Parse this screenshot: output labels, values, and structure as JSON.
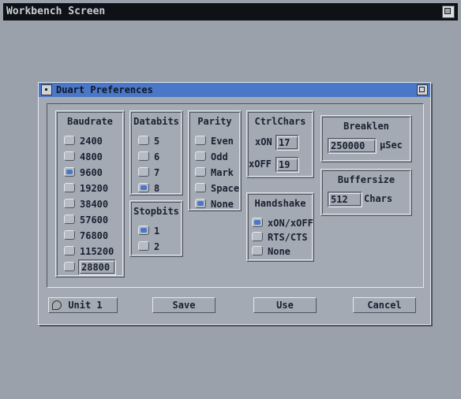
{
  "screen": {
    "title": "Workbench Screen"
  },
  "window": {
    "title": "Duart Preferences"
  },
  "baudrate": {
    "title": "Baudrate",
    "options": [
      {
        "label": "2400",
        "selected": false
      },
      {
        "label": "4800",
        "selected": false
      },
      {
        "label": "9600",
        "selected": true
      },
      {
        "label": "19200",
        "selected": false
      },
      {
        "label": "38400",
        "selected": false
      },
      {
        "label": "57600",
        "selected": false
      },
      {
        "label": "76800",
        "selected": false
      },
      {
        "label": "115200",
        "selected": false
      }
    ],
    "custom_value": "28800"
  },
  "databits": {
    "title": "Databits",
    "options": [
      {
        "label": "5",
        "selected": false
      },
      {
        "label": "6",
        "selected": false
      },
      {
        "label": "7",
        "selected": false
      },
      {
        "label": "8",
        "selected": true
      }
    ]
  },
  "stopbits": {
    "title": "Stopbits",
    "options": [
      {
        "label": "1",
        "selected": true
      },
      {
        "label": "2",
        "selected": false
      }
    ]
  },
  "parity": {
    "title": "Parity",
    "options": [
      {
        "label": "Even",
        "selected": false
      },
      {
        "label": "Odd",
        "selected": false
      },
      {
        "label": "Mark",
        "selected": false
      },
      {
        "label": "Space",
        "selected": false
      },
      {
        "label": "None",
        "selected": true
      }
    ]
  },
  "ctrlchars": {
    "title": "CtrlChars",
    "xon_label": "xON",
    "xon_value": "17",
    "xoff_label": "xOFF",
    "xoff_value": "19"
  },
  "handshake": {
    "title": "Handshake",
    "options": [
      {
        "label": "xON/xOFF",
        "selected": true
      },
      {
        "label": "RTS/CTS",
        "selected": false
      },
      {
        "label": "None",
        "selected": false
      }
    ]
  },
  "breaklen": {
    "title": "Breaklen",
    "value": "250000",
    "unit": "µSec"
  },
  "buffersize": {
    "title": "Buffersize",
    "value": "512",
    "unit": "Chars"
  },
  "buttons": {
    "unit": "Unit 1",
    "save": "Save",
    "use": "Use",
    "cancel": "Cancel"
  },
  "colors": {
    "accent": "#4a77c7",
    "background": "#9aa1ab",
    "panel": "#a4aab3"
  }
}
